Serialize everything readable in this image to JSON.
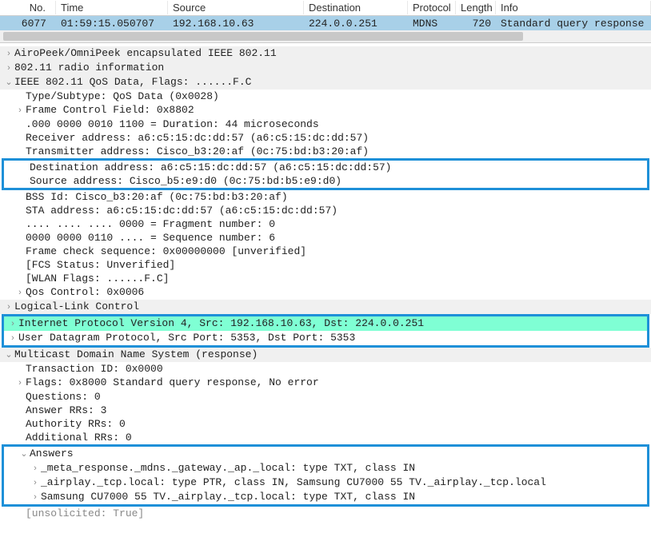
{
  "columns": {
    "no": "No.",
    "time": "Time",
    "source": "Source",
    "destination": "Destination",
    "protocol": "Protocol",
    "length": "Length",
    "info": "Info"
  },
  "packet": {
    "no": "6077",
    "time": "01:59:15.050707",
    "source": "192.168.10.63",
    "destination": "224.0.0.251",
    "protocol": "MDNS",
    "length": "720",
    "info": "Standard query response"
  },
  "tree": {
    "airopeek": "AiroPeek/OmniPeek encapsulated IEEE 802.11",
    "radio": "802.11 radio information",
    "ieee_header": "IEEE 802.11 QoS Data, Flags: ......F.C",
    "type_subtype": "Type/Subtype: QoS Data (0x0028)",
    "frame_ctrl": "Frame Control Field: 0x8802",
    "duration": ".000 0000 0010 1100 = Duration: 44 microseconds",
    "rcv_addr": "Receiver address: a6:c5:15:dc:dd:57 (a6:c5:15:dc:dd:57)",
    "trans_addr": "Transmitter address: Cisco_b3:20:af (0c:75:bd:b3:20:af)",
    "dest_addr": "Destination address: a6:c5:15:dc:dd:57 (a6:c5:15:dc:dd:57)",
    "src_addr": "Source address: Cisco_b5:e9:d0 (0c:75:bd:b5:e9:d0)",
    "bss_id": "BSS Id: Cisco_b3:20:af (0c:75:bd:b3:20:af)",
    "sta_addr": "STA address: a6:c5:15:dc:dd:57 (a6:c5:15:dc:dd:57)",
    "frag": ".... .... .... 0000 = Fragment number: 0",
    "seq": "0000 0000 0110 .... = Sequence number: 6",
    "fcs": "Frame check sequence: 0x00000000 [unverified]",
    "fcs_status": "[FCS Status: Unverified]",
    "wlan_flags": "[WLAN Flags: ......F.C]",
    "qos_ctrl": "Qos Control: 0x0006",
    "llc": "Logical-Link Control",
    "ipv4": "Internet Protocol Version 4, Src: 192.168.10.63, Dst: 224.0.0.251",
    "udp": "User Datagram Protocol, Src Port: 5353, Dst Port: 5353",
    "mdns": "Multicast Domain Name System (response)",
    "trans_id": "Transaction ID: 0x0000",
    "flags": "Flags: 0x8000 Standard query response, No error",
    "questions": "Questions: 0",
    "answer_rrs": "Answer RRs: 3",
    "authority_rrs": "Authority RRs: 0",
    "additional_rrs": "Additional RRs: 0",
    "answers_label": "Answers",
    "ans1": "_meta_response._mdns._gateway._ap._local: type TXT, class IN",
    "ans2": "_airplay._tcp.local: type PTR, class IN, Samsung CU7000 55 TV._airplay._tcp.local",
    "ans3": "Samsung CU7000 55 TV._airplay._tcp.local: type TXT, class IN",
    "truncated": "[unsolicited: True]"
  }
}
